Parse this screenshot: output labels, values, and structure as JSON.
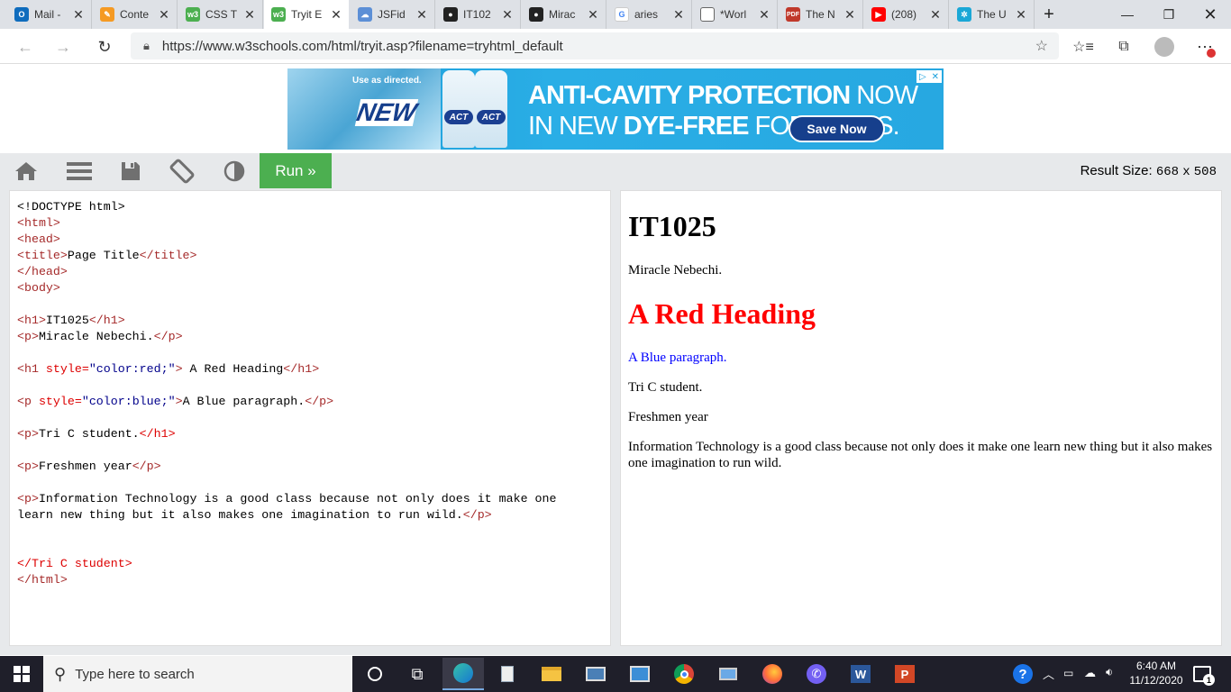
{
  "browser": {
    "tabs": [
      {
        "label": "Mail -",
        "icon": "outlook-icon",
        "color": "#0f6cbd"
      },
      {
        "label": "Conte",
        "icon": "pencil-icon",
        "color": "#f59a23"
      },
      {
        "label": "CSS T",
        "icon": "w3schools-icon",
        "color": "#4caf50"
      },
      {
        "label": "Tryit E",
        "icon": "w3schools-icon",
        "color": "#4caf50"
      },
      {
        "label": "JSFid",
        "icon": "cloud-icon",
        "color": "#5c8fd6"
      },
      {
        "label": "IT102",
        "icon": "github-icon",
        "color": "#222222"
      },
      {
        "label": "Mirac",
        "icon": "github-icon",
        "color": "#222222"
      },
      {
        "label": "aries",
        "icon": "google-icon",
        "color": "#4285f4"
      },
      {
        "label": "*Worl",
        "icon": "document-icon",
        "color": "#666666"
      },
      {
        "label": "The N",
        "icon": "pdf-icon",
        "color": "#c0392b"
      },
      {
        "label": "(208)",
        "icon": "youtube-icon",
        "color": "#ff0000"
      },
      {
        "label": "The U",
        "icon": "gear-icon",
        "color": "#1aa7d6"
      }
    ],
    "active_tab": 3,
    "url": "https://www.w3schools.com/html/tryit.asp?filename=tryhtml_default"
  },
  "ad": {
    "use_text": "Use as directed.",
    "badge": "NEW",
    "bottle_label": "ACT",
    "headline1_bold": "ANTI-CAVITY PROTECTION",
    "headline1_rest": " NOW",
    "headline2_pre": "IN NEW ",
    "headline2_bold": "DYE-FREE",
    "headline2_post": " FORMULAS.",
    "cta": "Save Now"
  },
  "tryit": {
    "run_label": "Run »",
    "result_size_label": "Result Size:",
    "result_width": "668",
    "result_x": "x",
    "result_height": "508"
  },
  "code": {
    "doctype": "<!DOCTYPE html>",
    "html_open": "<html>",
    "head_open": "<head>",
    "title_open": "<title>",
    "title_text": "Page Title",
    "title_close": "</title>",
    "head_close": "</head>",
    "body_open": "<body>",
    "h1_open": "<h1>",
    "h1_text": "IT1025",
    "h1_close": "</h1>",
    "p_open": "<p>",
    "p1_text": "Miracle Nebechi.",
    "p_close": "</p>",
    "h1b_open": "<h1 ",
    "h1b_attr": "style=",
    "h1b_val": "\"color:red;\"",
    "h1b_end": ">",
    "h1b_text": " A Red Heading",
    "p2_open": "<p ",
    "p2_attr": "style=",
    "p2_val": "\"color:blue;\"",
    "p2_end": ">",
    "p2_text": "A Blue paragraph.",
    "p3_text": "Tri C student.",
    "p4_text": "Freshmen year",
    "p5_text_line1": "Information Technology is a good class because not only does it make one",
    "p5_text_line2": "learn new thing but it also makes one imagination to run wild.",
    "close_tri": "</Tri C student>",
    "html_close": "</html>"
  },
  "result": {
    "h1": "IT1025",
    "p1": "Miracle Nebechi.",
    "red_heading": "A Red Heading",
    "blue_para": "A Blue paragraph.",
    "p3": "Tri C student.",
    "p4": "Freshmen year",
    "p5": "Information Technology is a good class because not only does it make one learn new thing but it also makes one imagination to run wild."
  },
  "taskbar": {
    "search_placeholder": "Type here to search",
    "time": "6:40 AM",
    "date": "11/12/2020",
    "notification_count": "1"
  }
}
